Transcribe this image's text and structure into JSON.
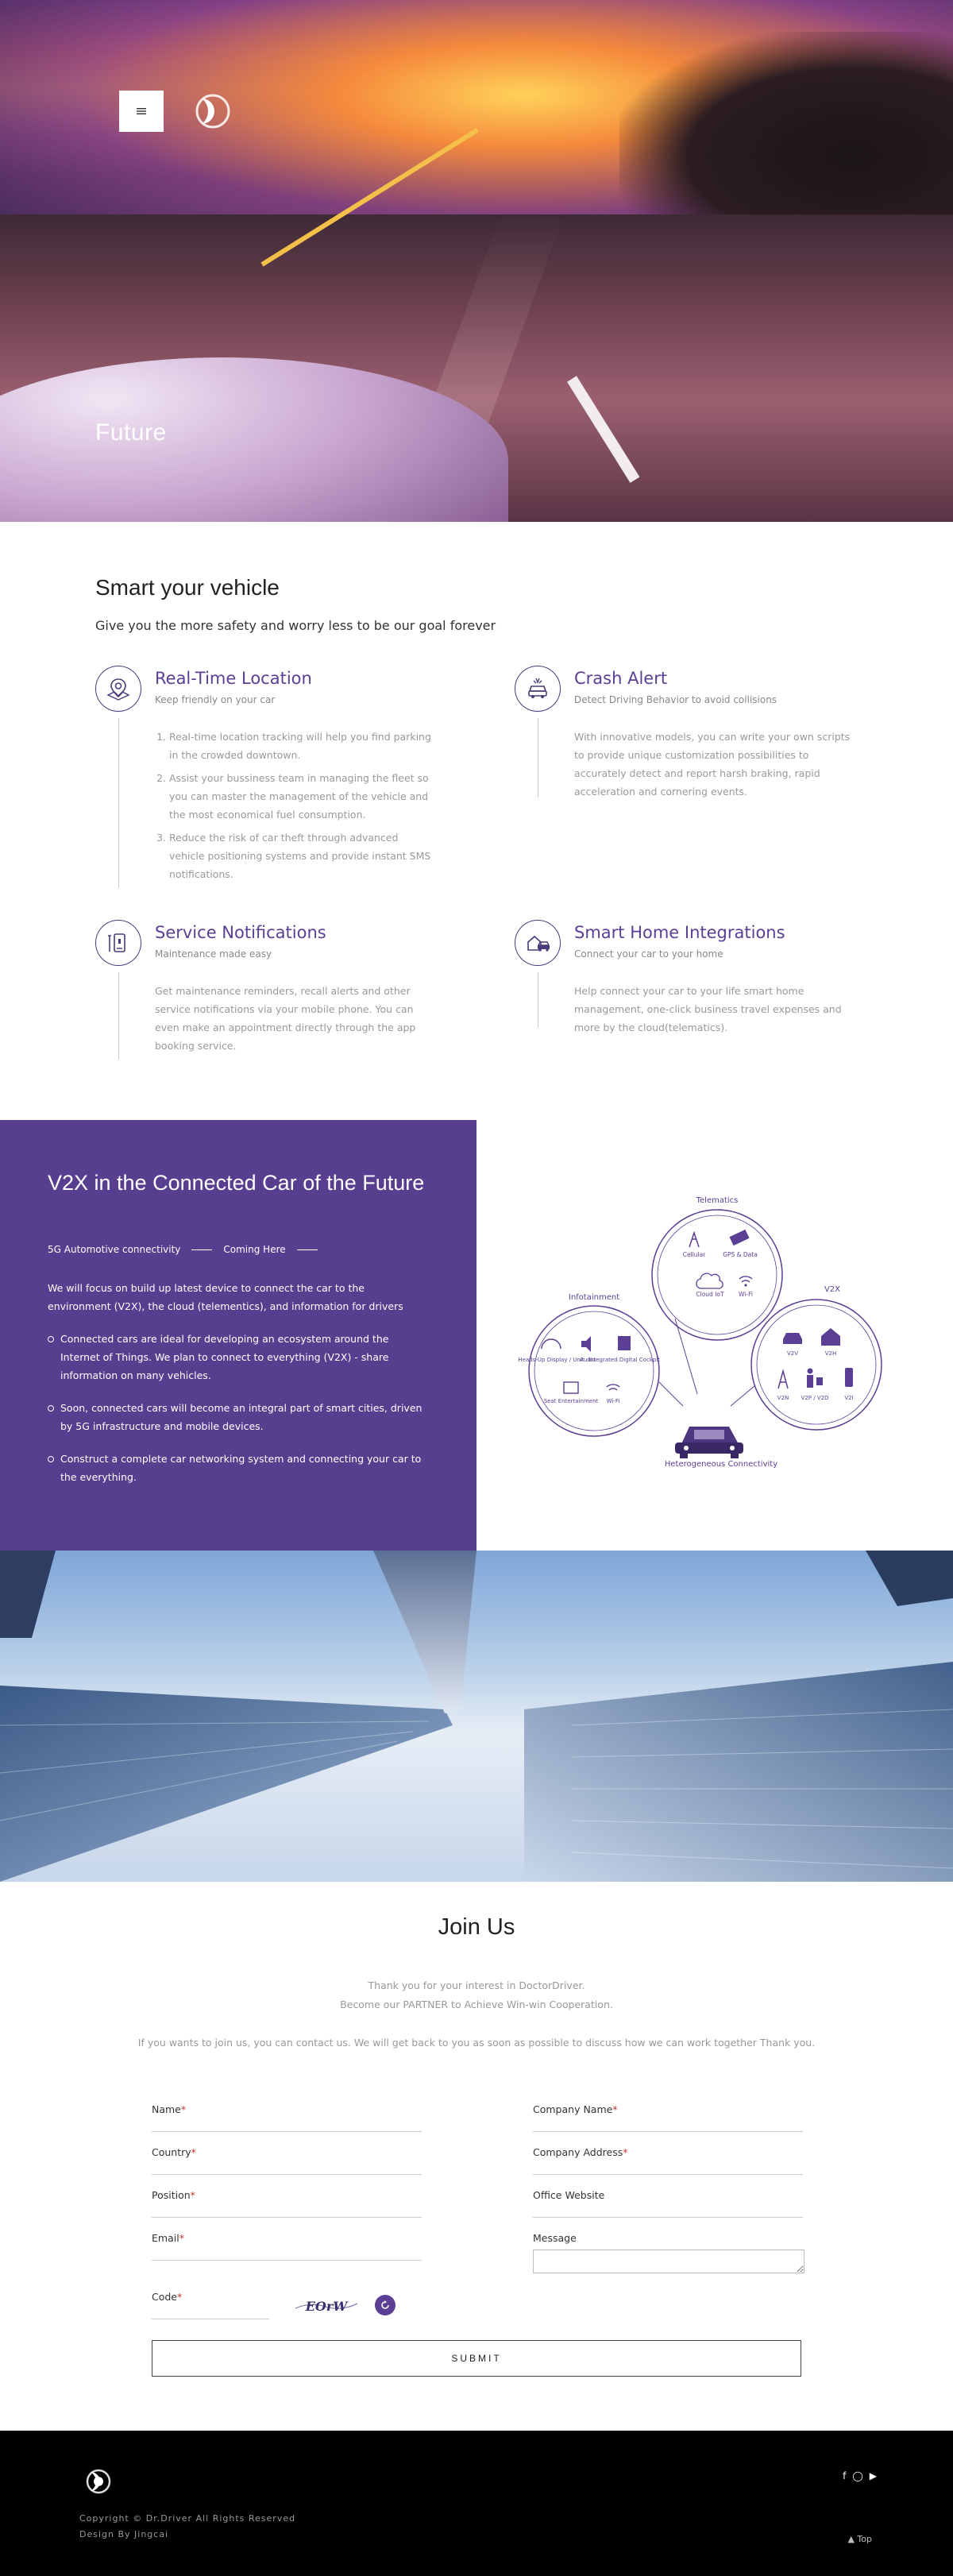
{
  "hero": {
    "menu_icon": "hamburger-icon",
    "title": "Future"
  },
  "intro": {
    "title": "Smart your vehicle",
    "subtitle": "Give you the more safety and worry less to be our goal forever"
  },
  "features": [
    {
      "icon": "location-pin-icon",
      "title": "Real-Time Location",
      "subtitle": "Keep friendly on your car",
      "items": [
        "Real-time location tracking will help you find parking in the crowded downtown.",
        "Assist your bussiness team in managing the fleet so you can master the management of the vehicle and the most economical fuel consumption.",
        "Reduce the risk of car theft through advanced vehicle positioning systems and provide instant SMS notifications."
      ]
    },
    {
      "icon": "car-crash-icon",
      "title": "Crash Alert",
      "subtitle": "Detect Driving Behavior to avoid collisions",
      "body": "With innovative models, you can write your own scripts to provide unique customization possibilities to accurately detect and report harsh braking, rapid acceleration and cornering events."
    },
    {
      "icon": "service-tools-icon",
      "title": "Service Notifications",
      "subtitle": "Maintenance made easy",
      "body": "Get maintenance reminders, recall alerts and other service notifications via your mobile phone. You can even make an appointment directly through the app booking service."
    },
    {
      "icon": "smart-home-icon",
      "title": "Smart Home Integrations",
      "subtitle": "Connect your car to your home",
      "body": "Help connect your car to your life smart home management, one-click business travel expenses and more by the cloud(telematics)."
    }
  ],
  "v2x": {
    "title": "V2X in the Connected Car of the Future",
    "tag_left": "5G Automotive connectivity",
    "tag_right": "Coming Here",
    "intro": "We will focus on build up latest device to connect the car to the environment (V2X), the cloud (telementics), and information for drivers",
    "bullets": [
      "Connected cars are ideal for developing an ecosystem around the Internet of Things. We plan to connect to everything (V2X) - share information on many vehicles.",
      "Soon, connected cars will become an integral part of smart cities, driven by 5G infrastructure and mobile devices.",
      "Construct a complete car networking system and connecting your car to the everything."
    ],
    "diagram": {
      "telematics": "Telematics",
      "infotainment": "Infotainment",
      "v2x": "V2X",
      "bottom": "Heterogeneous Connectivity",
      "tele_items": [
        "Cellular",
        "GPS & Data",
        "Cloud IoT",
        "Wi-Fi"
      ],
      "info_items": [
        "Heads-Up Display / Unit",
        "Audio",
        "Integrated Digital Cockpit",
        "Seat Entertainment",
        "Wi-Fi"
      ],
      "v2x_items": [
        "V2V",
        "V2H",
        "V2N",
        "V2P / V2D",
        "V2I"
      ]
    }
  },
  "join": {
    "title": "Join Us",
    "line1": "Thank you for your interest in DoctorDriver.",
    "line2": "Become our PARTNER to Achieve Win-win Cooperation.",
    "line3": "If you wants to join us, you can contact us. We will get back to you as soon as possible to discuss how we can work together Thank you.",
    "fields": {
      "name": "Name",
      "country": "Country",
      "position": "Position",
      "email": "Email",
      "company_name": "Company Name",
      "company_address": "Company Address",
      "office_website": "Office Website",
      "message": "Message",
      "code": "Code"
    },
    "required_mark": "*",
    "captcha_text": "EOrW",
    "submit": "SUBMIT"
  },
  "footer": {
    "copyright": "Copyright © Dr.Driver All Rights Reserved",
    "design": "Design By Jingcai",
    "social": [
      "facebook-icon",
      "instagram-icon",
      "youtube-icon"
    ],
    "to_top": "▲ Top"
  }
}
